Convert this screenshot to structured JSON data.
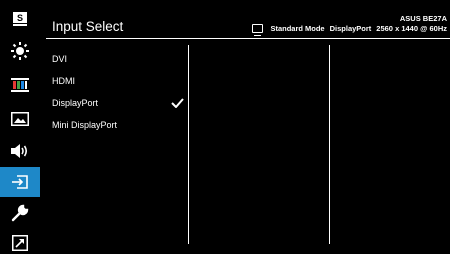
{
  "header": {
    "title": "Input Select",
    "model": "ASUS BE27A",
    "mode": "Standard Mode",
    "input": "DisplayPort",
    "resolution": "2560 x 1440 @ 60Hz"
  },
  "sidebar": {
    "items": [
      {
        "icon": "sharpness-s-icon"
      },
      {
        "icon": "brightness-icon"
      },
      {
        "icon": "color-bars-icon"
      },
      {
        "icon": "image-icon"
      },
      {
        "icon": "sound-icon"
      },
      {
        "icon": "input-select-icon",
        "active": true
      },
      {
        "icon": "wrench-icon"
      },
      {
        "icon": "shortcut-icon"
      }
    ]
  },
  "menu": {
    "options": [
      "DVI",
      "HDMI",
      "DisplayPort",
      "Mini DisplayPort"
    ],
    "selected": "DisplayPort"
  },
  "colors": {
    "accent": "#1e88c8",
    "background": "#000000",
    "text": "#ffffff"
  }
}
